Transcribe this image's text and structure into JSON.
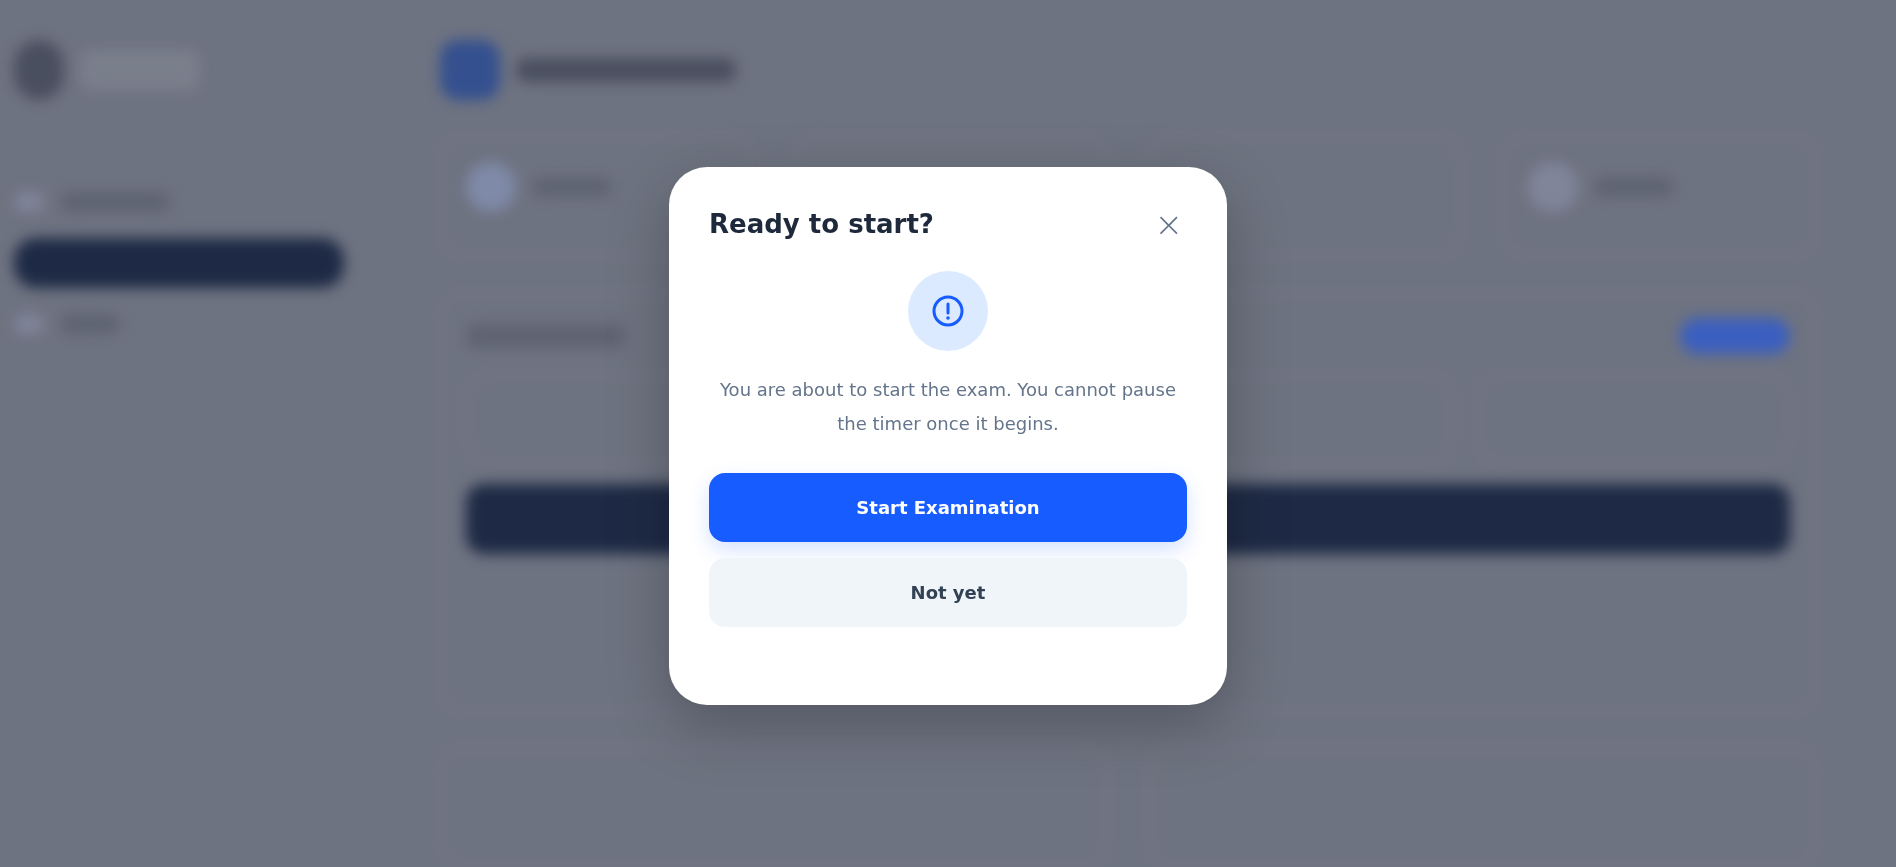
{
  "dialog": {
    "title": "Ready to start?",
    "close": "×",
    "message": "You are about to start the exam. You cannot pause the timer once it begins.",
    "buttons": [
      {
        "label": "Start Examination",
        "kind": "primary"
      },
      {
        "label": "Not yet",
        "kind": "secondary"
      }
    ]
  }
}
